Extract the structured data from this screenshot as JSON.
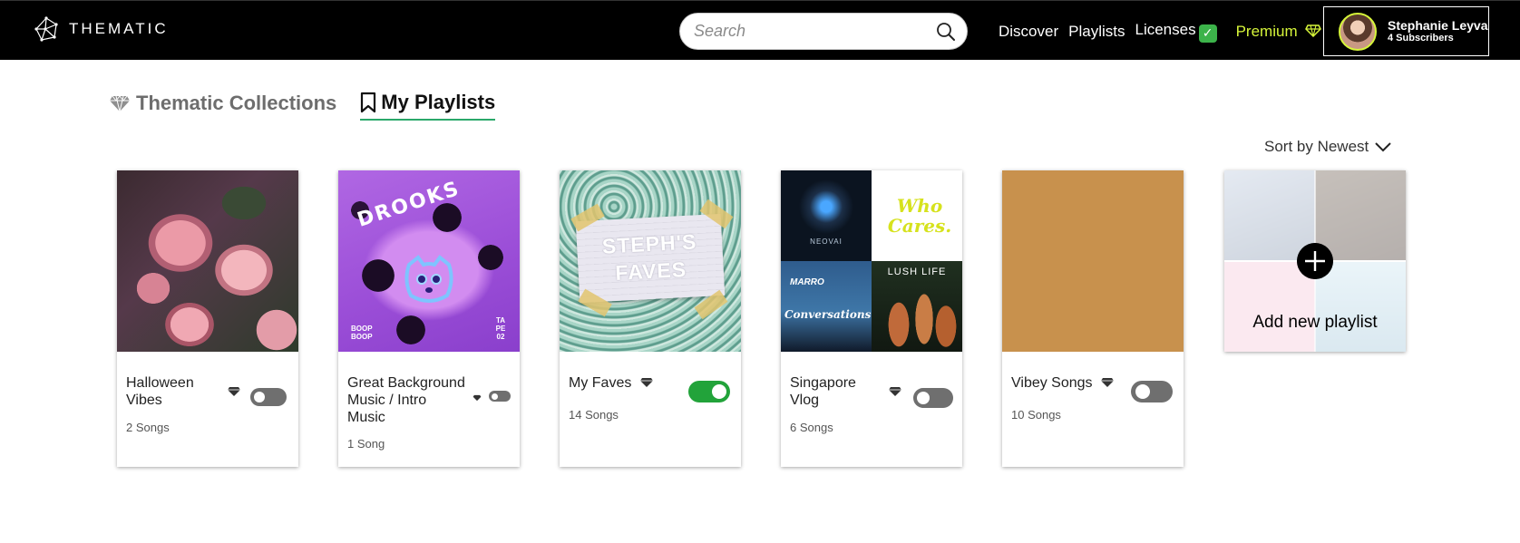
{
  "header": {
    "brand": "THEMATIC",
    "search_placeholder": "Search",
    "nav": {
      "discover": "Discover",
      "playlists": "Playlists",
      "licenses": "Licenses",
      "premium": "Premium"
    },
    "user": {
      "name": "Stephanie Leyva",
      "subscribers": "4 Subscribers"
    },
    "premium_color": "#d6f53a"
  },
  "tabs": [
    {
      "label": "Thematic Collections",
      "active": false,
      "icon": "gem-icon"
    },
    {
      "label": "My Playlists",
      "active": true,
      "icon": "bookmark-icon"
    }
  ],
  "sort": {
    "label": "Sort by Newest"
  },
  "playlists": [
    {
      "title": "Halloween Vibes",
      "count": "2 Songs",
      "premium": true,
      "enabled": false
    },
    {
      "title": "Great Background Music / Intro Music",
      "count": "1 Song",
      "premium": true,
      "enabled": false
    },
    {
      "title": "My Faves",
      "count": "14 Songs",
      "premium": true,
      "enabled": true
    },
    {
      "title": "Singapore Vlog",
      "count": "6 Songs",
      "premium": true,
      "enabled": false
    },
    {
      "title": "Vibey Songs",
      "count": "10 Songs",
      "premium": true,
      "enabled": false
    }
  ],
  "covers": {
    "drooks_title": "DROOKS",
    "drooks_boop": "BOOP BOOP",
    "drooks_tape": "TA PE 02",
    "faves_text": "STEPH'S FAVES",
    "neovai": "NEOVAI",
    "who_cares": "Who Cares.",
    "marro": "MARRO",
    "conversations": "Conversations",
    "lush_life": "LUSH LIFE"
  },
  "add_playlist": {
    "label": "Add new playlist"
  },
  "colors": {
    "toggle_on": "#22a33a",
    "toggle_off": "#6f6f6f",
    "tab_underline": "#2aa86a"
  }
}
